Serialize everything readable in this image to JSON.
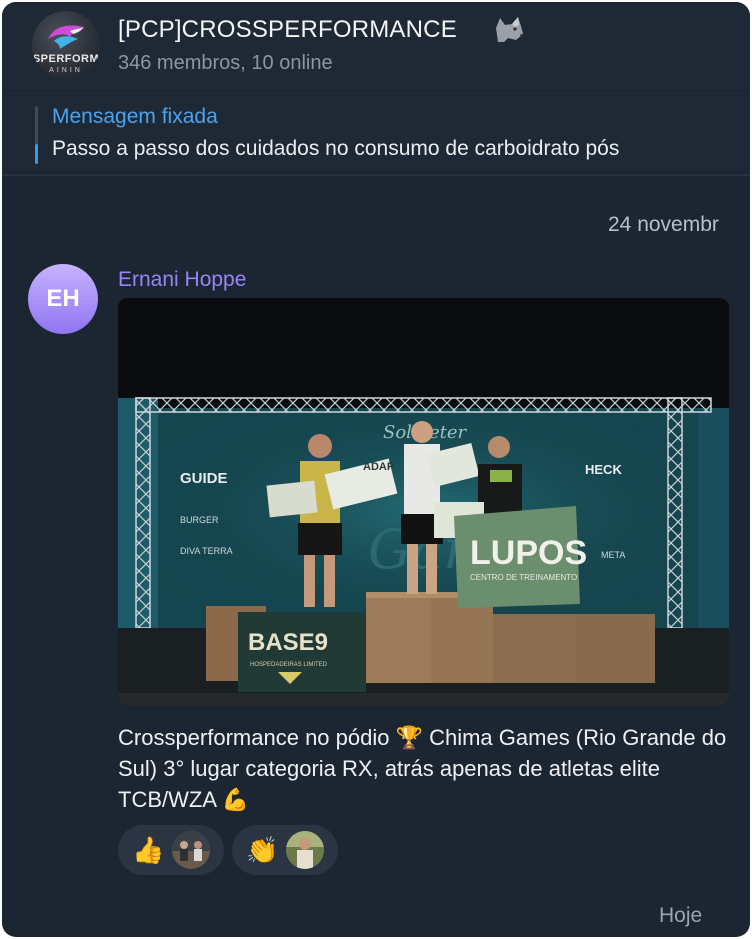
{
  "header": {
    "group_name": "[PCP]CROSSPERFORMANCE",
    "title_icon": "wolf-icon",
    "subtitle": "346 membros, 10 online",
    "avatar_logo_text": "SPERFORM",
    "avatar_logo_sub": "AININ"
  },
  "pinned": {
    "label": "Mensagem fixada",
    "text": "Passo a passo dos cuidados no consumo de carboidrato pós"
  },
  "date_chip": "24 novembr",
  "message": {
    "sender_initials": "EH",
    "sender_name": "Ernani Hoppe",
    "photo": {
      "banner_left": "GUIDE",
      "banner_mid": "ADAP",
      "banner_right": "HECK",
      "flag_text": "LUPOS",
      "flag_sub": "CENTRO DE TREINAMENTO",
      "box_banner": "BASE9",
      "box_banner_sub": "HOSPEDADEIRAS LIMITED",
      "banner_brand_a": "DIVA TERRA",
      "banner_brand_b": "META"
    },
    "caption": "Crossperformance no pódio 🏆 Chima Games (Rio Grande do Sul) 3° lugar categoria RX, atrás apenas de atletas elite TCB/WZA 💪",
    "reactions": [
      {
        "emoji": "👍",
        "icon": "thumbs-up-icon"
      },
      {
        "emoji": "👏",
        "icon": "clapping-hands-icon"
      }
    ],
    "time": "Hoje"
  },
  "colors": {
    "background": "#1c2532",
    "header": "#1f2936",
    "accent_link": "#4aa3ee",
    "sender_name": "#9a84f2",
    "avatar_gradient_top": "#c6b3ff",
    "avatar_gradient_bottom": "#8f75f0"
  }
}
